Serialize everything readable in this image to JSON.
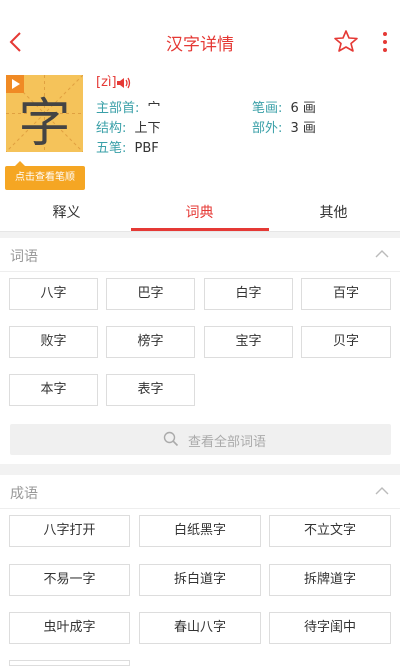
{
  "header": {
    "title": "汉字详情"
  },
  "character": {
    "glyph": "字",
    "pinyin": "[zì]",
    "stroke_order_label": "点击查看笔顺",
    "radical_label": "主部首:",
    "radical_value": "宀",
    "strokes_label": "笔画:",
    "strokes_value": "6 画",
    "structure_label": "结构:",
    "structure_value": "上下",
    "outer_label": "部外:",
    "outer_value": "3 画",
    "wubi_label": "五笔:",
    "wubi_value": "PBF"
  },
  "tabs": [
    {
      "label": "释义",
      "active": false
    },
    {
      "label": "词典",
      "active": true
    },
    {
      "label": "其他",
      "active": false
    }
  ],
  "words": {
    "title": "词语",
    "items": [
      "八字",
      "巴字",
      "白字",
      "百字",
      "败字",
      "榜字",
      "宝字",
      "贝字",
      "本字",
      "表字"
    ],
    "view_all": "查看全部词语"
  },
  "idioms": {
    "title": "成语",
    "items": [
      "八字打开",
      "白纸黑字",
      "不立文字",
      "不易一字",
      "拆白道字",
      "拆牌道字",
      "虫叶成字",
      "春山八字",
      "待字闺中"
    ]
  },
  "colors": {
    "accent": "#e53935",
    "label": "#3aa0a8",
    "stroke_button": "#f5a623"
  }
}
